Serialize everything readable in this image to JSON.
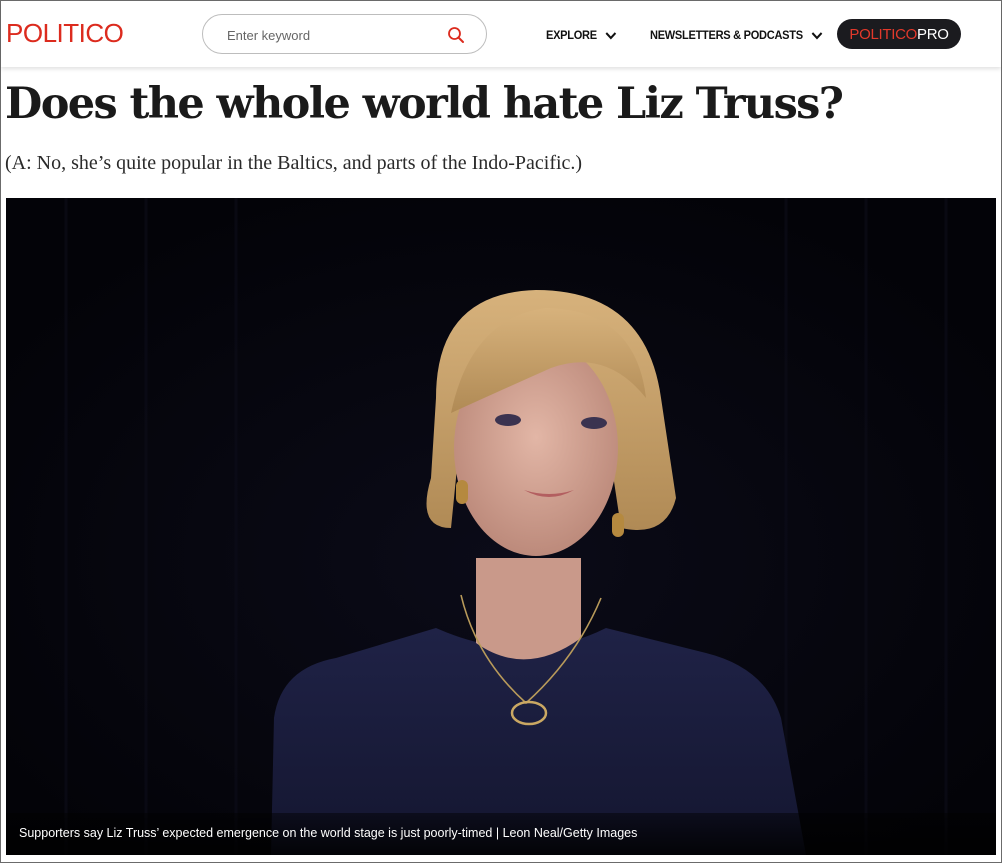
{
  "header": {
    "logo": "POLITICO",
    "search": {
      "placeholder": "Enter keyword",
      "value": ""
    },
    "nav": [
      {
        "label": "EXPLORE"
      },
      {
        "label": "NEWSLETTERS & PODCASTS"
      }
    ],
    "pro_button": {
      "part1": "POLITICO",
      "part2": "PRO"
    }
  },
  "article": {
    "headline": "Does the whole world hate Liz Truss?",
    "dek": "(A: No, she’s quite popular in the Baltics, and parts of the Indo-Pacific.)",
    "image": {
      "caption": "Supporters say Liz Truss’    expected emergence on the world stage is just poorly-timed | Leon Neal/Getty Images"
    }
  },
  "colors": {
    "brand_red": "#dc2b1e",
    "pro_button_bg": "#1b1b1f",
    "photo_background": "#05050d"
  },
  "icons": [
    "search-icon",
    "chevron-down-icon"
  ]
}
